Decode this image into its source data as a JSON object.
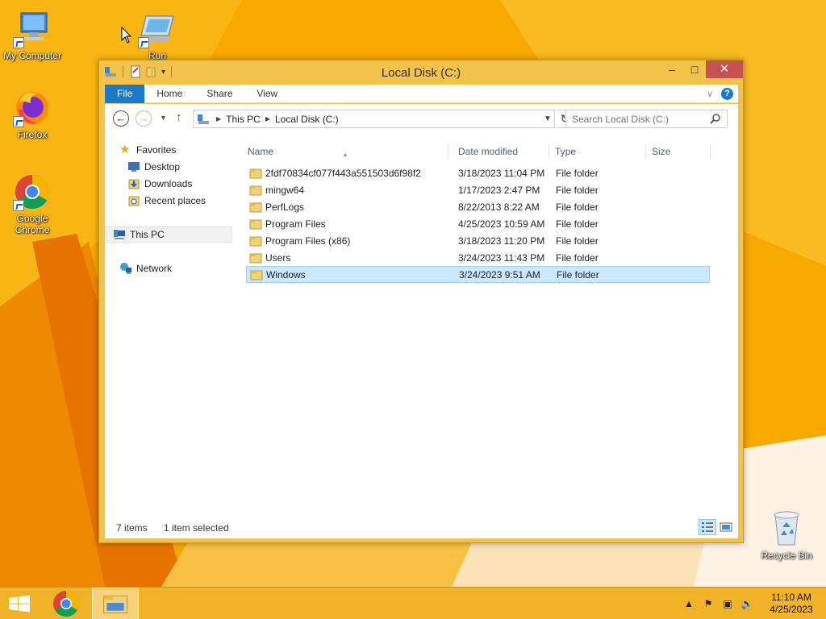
{
  "desktop": {
    "icons": [
      {
        "label": "My Computer"
      },
      {
        "label": "Run"
      },
      {
        "label": "Firefox"
      },
      {
        "label": "Google Chrome"
      },
      {
        "label": "Recycle Bin"
      }
    ]
  },
  "window": {
    "title": "Local Disk (C:)",
    "controls": {
      "minimize": "–",
      "maximize": "□",
      "close": "✕"
    },
    "ribbon_tabs": [
      "File",
      "Home",
      "Share",
      "View"
    ],
    "help": "?",
    "address": {
      "segments": [
        "This PC",
        "Local Disk (C:)"
      ]
    },
    "search_placeholder": "Search Local Disk (C:)",
    "nav_pane": {
      "favorites": "Favorites",
      "favorites_items": [
        "Desktop",
        "Downloads",
        "Recent places"
      ],
      "this_pc": "This PC",
      "network": "Network"
    },
    "columns": [
      "Name",
      "Date modified",
      "Type",
      "Size"
    ],
    "rows": [
      {
        "name": "2fdf70834cf077f443a551503d6f98f2",
        "date": "3/18/2023 11:04 PM",
        "type": "File folder"
      },
      {
        "name": "mingw64",
        "date": "1/17/2023 2:47 PM",
        "type": "File folder"
      },
      {
        "name": "PerfLogs",
        "date": "8/22/2013 8:22 AM",
        "type": "File folder"
      },
      {
        "name": "Program Files",
        "date": "4/25/2023 10:59 AM",
        "type": "File folder"
      },
      {
        "name": "Program Files (x86)",
        "date": "3/18/2023 11:20 PM",
        "type": "File folder"
      },
      {
        "name": "Users",
        "date": "3/24/2023 11:43 PM",
        "type": "File folder"
      },
      {
        "name": "Windows",
        "date": "3/24/2023 9:51 AM",
        "type": "File folder",
        "selected": true
      }
    ],
    "status": {
      "items": "7 items",
      "selected": "1 item selected"
    }
  },
  "taskbar": {
    "clock_time": "11:10 AM",
    "clock_date": "4/25/2023"
  },
  "colors": {
    "accent": "#1979ca",
    "window_frame": "#f2c24a",
    "selection": "#cce8ff",
    "close_button": "#c75050"
  }
}
